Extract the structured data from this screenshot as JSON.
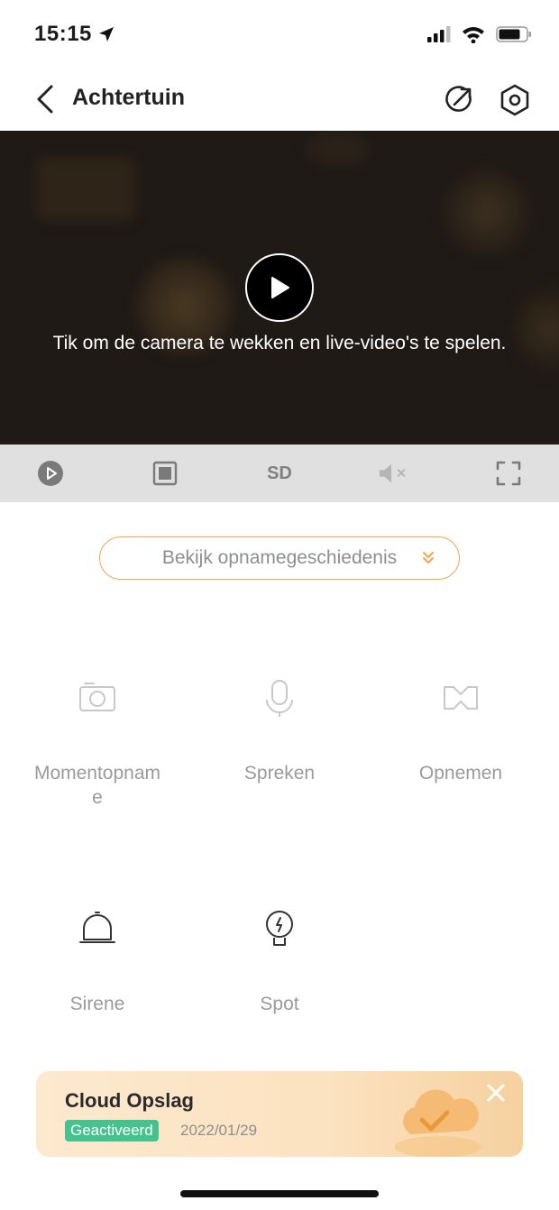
{
  "status": {
    "time": "15:15",
    "location_icon": "location-arrow-icon",
    "signal_icon": "cellular-signal-icon",
    "wifi_icon": "wifi-icon",
    "battery_icon": "battery-icon"
  },
  "nav": {
    "title": "Achtertuin",
    "back_icon": "chevron-left-icon",
    "share_icon": "share-arrow-icon",
    "settings_icon": "hexagon-gear-icon"
  },
  "video": {
    "message": "Tik om de camera te wekken en live-video's te spelen.",
    "play_icon": "play-icon",
    "background": "#1f1a16"
  },
  "controls": {
    "play_icon": "play-circle-icon",
    "stop_icon": "stop-square-icon",
    "quality_label": "SD",
    "mute_icon": "speaker-muted-icon",
    "fullscreen_icon": "fullscreen-icon"
  },
  "history": {
    "label": "Bekijk opnamegeschiedenis",
    "chevron_icon": "double-chevron-down-icon",
    "accent": "#f2a54a"
  },
  "features": [
    {
      "label": "Momentopnam\ne",
      "icon": "camera-icon"
    },
    {
      "label": "Spreken",
      "icon": "microphone-icon"
    },
    {
      "label": "Opnemen",
      "icon": "video-record-icon"
    },
    {
      "label": "Sirene",
      "icon": "siren-icon"
    },
    {
      "label": "Spot",
      "icon": "lightbulb-icon"
    }
  ],
  "cloud": {
    "title": "Cloud Opslag",
    "badge": "Geactiveerd",
    "date": "2022/01/29",
    "close_icon": "close-icon",
    "illustration_icon": "cloud-check-icon",
    "badge_color": "#45c28e"
  }
}
